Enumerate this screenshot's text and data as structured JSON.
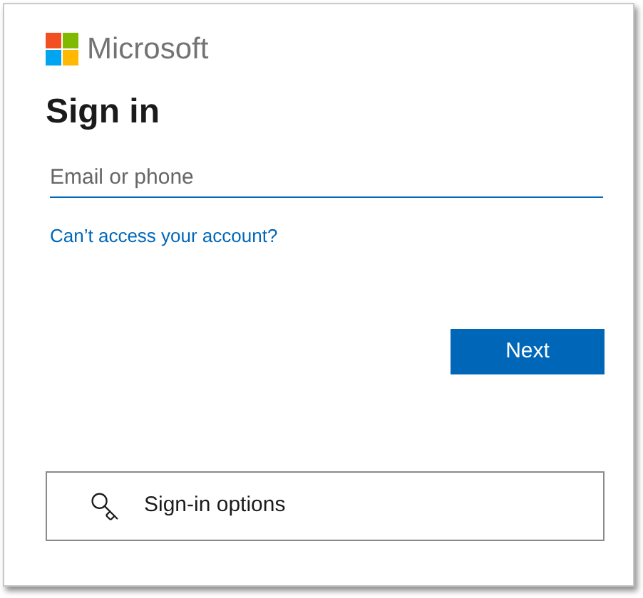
{
  "logo": {
    "text": "Microsoft"
  },
  "heading": "Sign in",
  "email_field": {
    "placeholder": "Email or phone"
  },
  "help_link": "Can’t access your account?",
  "next_button": "Next",
  "options_button": "Sign-in options"
}
